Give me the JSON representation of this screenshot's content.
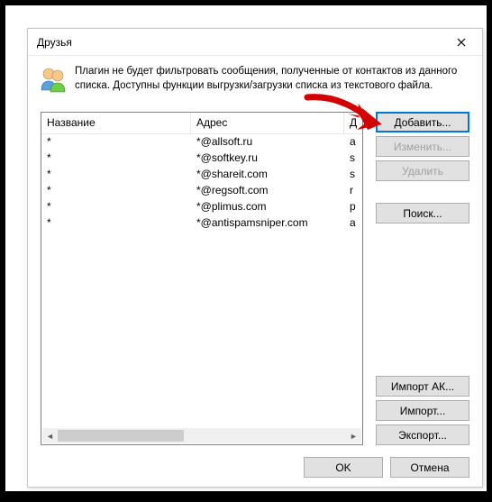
{
  "window": {
    "title": "Друзья"
  },
  "info": {
    "text": "Плагин не будет фильтровать сообщения, полученные от контактов из данного списка. Доступны функции выгрузки/загрузки списка из текстового файла."
  },
  "table": {
    "headers": {
      "name": "Название",
      "address": "Адрес",
      "extra": "Д"
    },
    "rows": [
      {
        "name": "*",
        "address": "*@allsoft.ru",
        "extra": "a"
      },
      {
        "name": "*",
        "address": "*@softkey.ru",
        "extra": "s"
      },
      {
        "name": "*",
        "address": "*@shareit.com",
        "extra": "s"
      },
      {
        "name": "*",
        "address": "*@regsoft.com",
        "extra": "r"
      },
      {
        "name": "*",
        "address": "*@plimus.com",
        "extra": "p"
      },
      {
        "name": "*",
        "address": "*@antispamsniper.com",
        "extra": "a"
      }
    ]
  },
  "buttons": {
    "add": "Добавить...",
    "edit": "Изменить...",
    "delete": "Удалить",
    "search": "Поиск...",
    "import_ak": "Импорт АК...",
    "import": "Импорт...",
    "export": "Экспорт..."
  },
  "footer": {
    "ok": "OK",
    "cancel": "Отмена"
  }
}
